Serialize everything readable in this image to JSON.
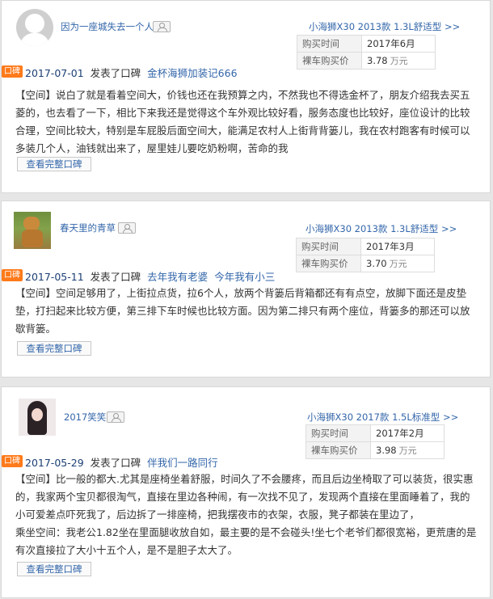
{
  "reviews": [
    {
      "username": "因为一座城失去一个人",
      "model": "小海狮X30 2013款 1.3L舒适型 >>",
      "purchase_time_label": "购买时间",
      "purchase_time": "2017年6月",
      "price_label": "裸车购买价",
      "price": "3.78",
      "price_unit": "万元",
      "tag": "口碑",
      "date": "2017-07-01",
      "action": "发表了口碑",
      "title": "金杯海狮加装记666",
      "content": "【空间】说白了就是看着空间大，价钱也还在我预算之内，不然我也不得选金杯了，朋友介绍我去买五菱的，也去看了一下，相比下来我还是觉得这个车外观比较好看，服务态度也比较好，座位设计的比较合理，空间比较大，特别是车屁股后面空间大，能满足农村人上街背背篓儿，我在农村跑客有时候可以多装几个人，油钱就出来了，屋里娃儿要吃奶粉啊，苦命的我",
      "button": "查看完整口碑"
    },
    {
      "username": "春天里的青草",
      "model": "小海狮X30 2013款 1.3L舒适型 >>",
      "purchase_time_label": "购买时间",
      "purchase_time": "2017年3月",
      "price_label": "裸车购买价",
      "price": "3.70",
      "price_unit": "万元",
      "tag": "口碑",
      "date": "2017-05-11",
      "action": "发表了口碑",
      "title": "去年我有老婆",
      "title2": "今年我有小三",
      "content": "【空间】空间足够用了，上街拉点货，拉6个人，放两个背篓后背箱都还有有点空，放脚下面还是皮垫垫，打扫起来比较方便，第三排下车时候也比较方面。因为第二排只有两个座位，背篓多的那还可以放歇背篓。",
      "button": "查看完整口碑"
    },
    {
      "username": "2017笑笑",
      "model": "小海狮X30 2017款 1.5L标准型 >>",
      "purchase_time_label": "购买时间",
      "purchase_time": "2017年2月",
      "price_label": "裸车购买价",
      "price": "3.98",
      "price_unit": "万元",
      "tag": "口碑",
      "date": "2017-05-29",
      "action": "发表了口碑",
      "title": "伴我们一路同行",
      "content": "【空间】比一般的都大.尤其是座椅坐着舒服，时间久了不会腰疼，而且后边坐椅取了可以装货，很实惠的，我家两个宝贝都很淘气，直接在里边各种闹，有一次找不见了，发现两个直接在里面睡着了，我的小可爱差点吓死我了，后边拆了一排座椅，把我摆夜市的衣架，衣服，凳子都装在里边了，",
      "content2": "乘坐空间：我老公1.82坐在里面腿收放自如，最主要的是不会碰头!坐七个老爷们都很宽裕，更荒唐的是有次直接拉了大小十五个人，是不是胆子太大了。",
      "button": "查看完整口碑"
    }
  ]
}
